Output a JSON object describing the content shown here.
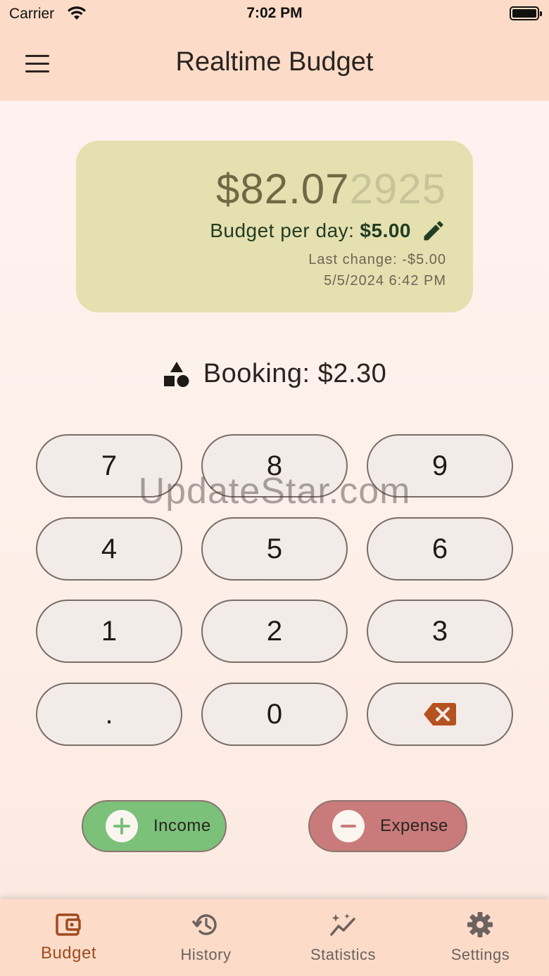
{
  "status_bar": {
    "carrier": "Carrier",
    "time": "7:02 PM"
  },
  "app_bar": {
    "title": "Realtime Budget",
    "menu_icon": "hamburger-menu-icon"
  },
  "balance": {
    "amount_main": "$82.07",
    "amount_fraction": "2925",
    "per_day_label": "Budget per day:",
    "per_day_value": "$5.00",
    "last_change": "Last change: -$5.00",
    "last_change_date": "5/5/2024 6:42 PM",
    "card_color": "#e5e0b0"
  },
  "booking": {
    "text": "Booking: $2.30",
    "icon": "shapes-icon"
  },
  "keypad": {
    "keys": [
      "7",
      "8",
      "9",
      "4",
      "5",
      "6",
      "1",
      "2",
      "3",
      ".",
      "0"
    ],
    "backspace_icon": "backspace-icon",
    "backspace_color": "#b5521f"
  },
  "watermark": "UpdateStar.com",
  "actions": {
    "income_label": "Income",
    "expense_label": "Expense",
    "income_color": "#7bc17a",
    "expense_color": "#c97b7b"
  },
  "nav": {
    "items": [
      {
        "label": "Budget",
        "icon": "wallet-icon",
        "active": true
      },
      {
        "label": "History",
        "icon": "history-icon",
        "active": false
      },
      {
        "label": "Statistics",
        "icon": "statistics-icon",
        "active": false
      },
      {
        "label": "Settings",
        "icon": "gear-icon",
        "active": false
      }
    ],
    "accent": "#a04a1f"
  }
}
